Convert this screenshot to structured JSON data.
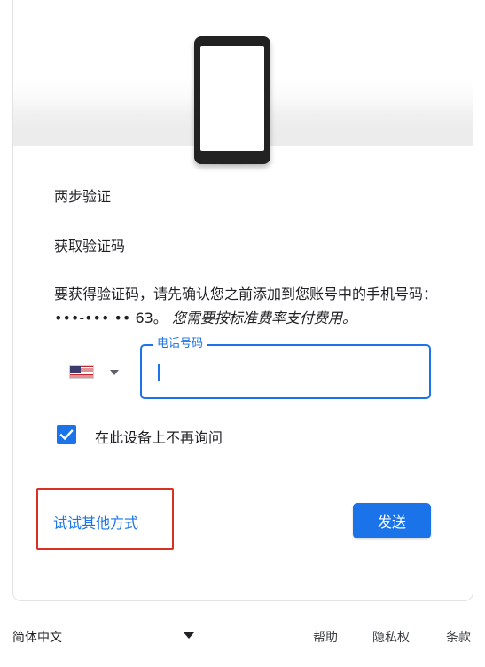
{
  "header": {
    "title": "两步验证",
    "subtitle": "获取验证码"
  },
  "description": {
    "text": "要获得验证码，请先确认您之前添加到您账号中的手机号码：",
    "masked_number": "•••-••• •• 63。",
    "notice": "您需要按标准费率支付费用。"
  },
  "phone_field": {
    "label": "电话号码",
    "value": "",
    "country_icon": "us-flag-icon"
  },
  "remember_checkbox": {
    "label": "在此设备上不再询问",
    "checked": true
  },
  "actions": {
    "try_other": "试试其他方式",
    "send": "发送"
  },
  "footer": {
    "language": "简体中文",
    "help": "帮助",
    "privacy": "隐私权",
    "terms": "条款"
  },
  "colors": {
    "accent": "#1a73e8",
    "highlight": "#d93025"
  }
}
